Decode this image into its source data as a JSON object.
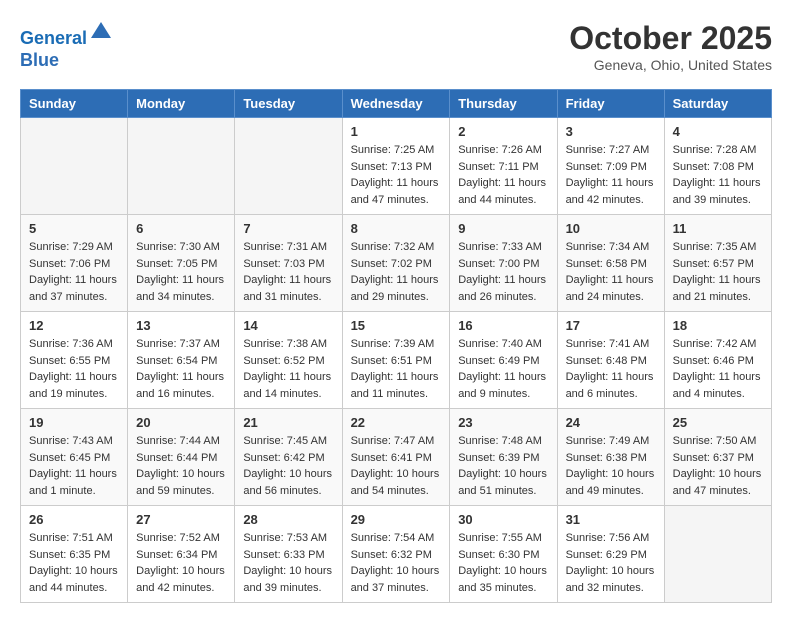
{
  "header": {
    "logo_line1": "General",
    "logo_line2": "Blue",
    "month": "October 2025",
    "location": "Geneva, Ohio, United States"
  },
  "weekdays": [
    "Sunday",
    "Monday",
    "Tuesday",
    "Wednesday",
    "Thursday",
    "Friday",
    "Saturday"
  ],
  "weeks": [
    [
      {
        "day": "",
        "info": ""
      },
      {
        "day": "",
        "info": ""
      },
      {
        "day": "",
        "info": ""
      },
      {
        "day": "1",
        "info": "Sunrise: 7:25 AM\nSunset: 7:13 PM\nDaylight: 11 hours\nand 47 minutes."
      },
      {
        "day": "2",
        "info": "Sunrise: 7:26 AM\nSunset: 7:11 PM\nDaylight: 11 hours\nand 44 minutes."
      },
      {
        "day": "3",
        "info": "Sunrise: 7:27 AM\nSunset: 7:09 PM\nDaylight: 11 hours\nand 42 minutes."
      },
      {
        "day": "4",
        "info": "Sunrise: 7:28 AM\nSunset: 7:08 PM\nDaylight: 11 hours\nand 39 minutes."
      }
    ],
    [
      {
        "day": "5",
        "info": "Sunrise: 7:29 AM\nSunset: 7:06 PM\nDaylight: 11 hours\nand 37 minutes."
      },
      {
        "day": "6",
        "info": "Sunrise: 7:30 AM\nSunset: 7:05 PM\nDaylight: 11 hours\nand 34 minutes."
      },
      {
        "day": "7",
        "info": "Sunrise: 7:31 AM\nSunset: 7:03 PM\nDaylight: 11 hours\nand 31 minutes."
      },
      {
        "day": "8",
        "info": "Sunrise: 7:32 AM\nSunset: 7:02 PM\nDaylight: 11 hours\nand 29 minutes."
      },
      {
        "day": "9",
        "info": "Sunrise: 7:33 AM\nSunset: 7:00 PM\nDaylight: 11 hours\nand 26 minutes."
      },
      {
        "day": "10",
        "info": "Sunrise: 7:34 AM\nSunset: 6:58 PM\nDaylight: 11 hours\nand 24 minutes."
      },
      {
        "day": "11",
        "info": "Sunrise: 7:35 AM\nSunset: 6:57 PM\nDaylight: 11 hours\nand 21 minutes."
      }
    ],
    [
      {
        "day": "12",
        "info": "Sunrise: 7:36 AM\nSunset: 6:55 PM\nDaylight: 11 hours\nand 19 minutes."
      },
      {
        "day": "13",
        "info": "Sunrise: 7:37 AM\nSunset: 6:54 PM\nDaylight: 11 hours\nand 16 minutes."
      },
      {
        "day": "14",
        "info": "Sunrise: 7:38 AM\nSunset: 6:52 PM\nDaylight: 11 hours\nand 14 minutes."
      },
      {
        "day": "15",
        "info": "Sunrise: 7:39 AM\nSunset: 6:51 PM\nDaylight: 11 hours\nand 11 minutes."
      },
      {
        "day": "16",
        "info": "Sunrise: 7:40 AM\nSunset: 6:49 PM\nDaylight: 11 hours\nand 9 minutes."
      },
      {
        "day": "17",
        "info": "Sunrise: 7:41 AM\nSunset: 6:48 PM\nDaylight: 11 hours\nand 6 minutes."
      },
      {
        "day": "18",
        "info": "Sunrise: 7:42 AM\nSunset: 6:46 PM\nDaylight: 11 hours\nand 4 minutes."
      }
    ],
    [
      {
        "day": "19",
        "info": "Sunrise: 7:43 AM\nSunset: 6:45 PM\nDaylight: 11 hours\nand 1 minute."
      },
      {
        "day": "20",
        "info": "Sunrise: 7:44 AM\nSunset: 6:44 PM\nDaylight: 10 hours\nand 59 minutes."
      },
      {
        "day": "21",
        "info": "Sunrise: 7:45 AM\nSunset: 6:42 PM\nDaylight: 10 hours\nand 56 minutes."
      },
      {
        "day": "22",
        "info": "Sunrise: 7:47 AM\nSunset: 6:41 PM\nDaylight: 10 hours\nand 54 minutes."
      },
      {
        "day": "23",
        "info": "Sunrise: 7:48 AM\nSunset: 6:39 PM\nDaylight: 10 hours\nand 51 minutes."
      },
      {
        "day": "24",
        "info": "Sunrise: 7:49 AM\nSunset: 6:38 PM\nDaylight: 10 hours\nand 49 minutes."
      },
      {
        "day": "25",
        "info": "Sunrise: 7:50 AM\nSunset: 6:37 PM\nDaylight: 10 hours\nand 47 minutes."
      }
    ],
    [
      {
        "day": "26",
        "info": "Sunrise: 7:51 AM\nSunset: 6:35 PM\nDaylight: 10 hours\nand 44 minutes."
      },
      {
        "day": "27",
        "info": "Sunrise: 7:52 AM\nSunset: 6:34 PM\nDaylight: 10 hours\nand 42 minutes."
      },
      {
        "day": "28",
        "info": "Sunrise: 7:53 AM\nSunset: 6:33 PM\nDaylight: 10 hours\nand 39 minutes."
      },
      {
        "day": "29",
        "info": "Sunrise: 7:54 AM\nSunset: 6:32 PM\nDaylight: 10 hours\nand 37 minutes."
      },
      {
        "day": "30",
        "info": "Sunrise: 7:55 AM\nSunset: 6:30 PM\nDaylight: 10 hours\nand 35 minutes."
      },
      {
        "day": "31",
        "info": "Sunrise: 7:56 AM\nSunset: 6:29 PM\nDaylight: 10 hours\nand 32 minutes."
      },
      {
        "day": "",
        "info": ""
      }
    ]
  ]
}
